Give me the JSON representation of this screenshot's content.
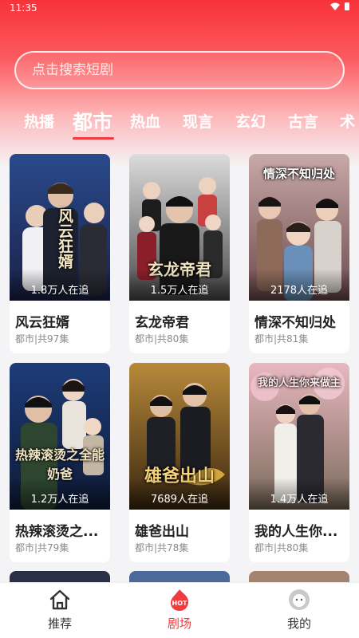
{
  "status": {
    "time": "11:35"
  },
  "search": {
    "placeholder": "点击搜索短剧"
  },
  "tabs": [
    {
      "label": "热播"
    },
    {
      "label": "都市"
    },
    {
      "label": "热血"
    },
    {
      "label": "现言"
    },
    {
      "label": "玄幻"
    },
    {
      "label": "古言"
    },
    {
      "label": "术"
    }
  ],
  "active_tab": "都市",
  "cards": [
    {
      "title": "风云狂婿",
      "meta": "都市|共97集",
      "followers": "1.8万人在追",
      "poster_text": "风云狂婿"
    },
    {
      "title": "玄龙帝君",
      "meta": "都市|共80集",
      "followers": "1.5万人在追",
      "poster_text": "玄龙帝君"
    },
    {
      "title": "情深不知归处",
      "meta": "都市|共81集",
      "followers": "2178人在追",
      "poster_text": "情深不知归处"
    },
    {
      "title": "热辣滚烫之...",
      "meta": "都市|共79集",
      "followers": "1.2万人在追",
      "poster_text": "热辣滚烫之全能奶爸"
    },
    {
      "title": "雄爸出山",
      "meta": "都市|共78集",
      "followers": "7689人在追",
      "poster_text": "雄爸出山"
    },
    {
      "title": "我的人生你...",
      "meta": "都市|共80集",
      "followers": "1.4万人在追",
      "poster_text": "我的人生你来做主"
    }
  ],
  "nav": [
    {
      "label": "推荐",
      "icon": "home-icon"
    },
    {
      "label": "剧场",
      "icon": "hot-icon",
      "badge": "HOT"
    },
    {
      "label": "我的",
      "icon": "profile-icon"
    }
  ],
  "colors": {
    "accent": "#f23b3f",
    "header_top": "#f8323a"
  }
}
